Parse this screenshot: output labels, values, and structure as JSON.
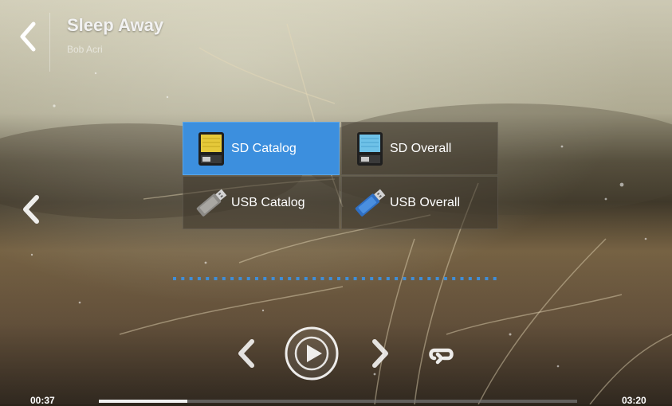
{
  "header": {
    "title": "Sleep Away",
    "artist": "Bob Acri"
  },
  "source_menu": {
    "items": [
      {
        "label": "SD Catalog",
        "icon": "sd-card-icon",
        "selected": true
      },
      {
        "label": "SD Overall",
        "icon": "sd-card-icon",
        "selected": false
      },
      {
        "label": "USB Catalog",
        "icon": "usb-drive-icon",
        "selected": false
      },
      {
        "label": "USB Overall",
        "icon": "usb-drive-icon",
        "selected": false
      }
    ]
  },
  "playback": {
    "elapsed": "00:37",
    "total": "03:20",
    "progress_fraction": 0.185
  },
  "colors": {
    "accent": "#3c8fde",
    "pager_dots": "#3f8ed8"
  }
}
